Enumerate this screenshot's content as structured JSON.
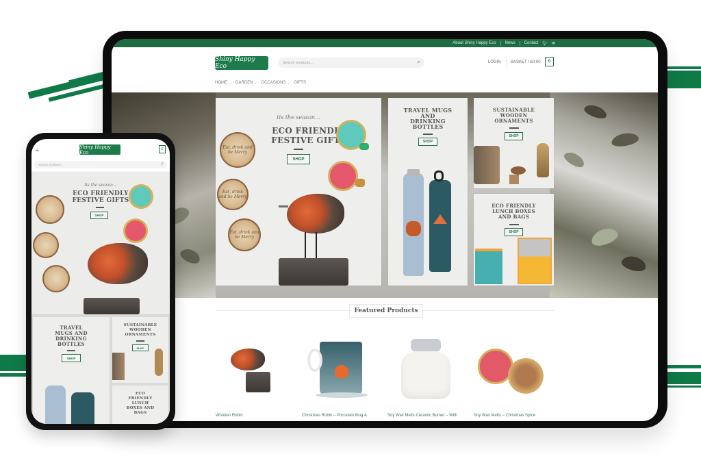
{
  "colors": {
    "brand_green": "#1f6b44",
    "link_green": "#3a7a57",
    "device_black": "#0c0c0c"
  },
  "desktop": {
    "topbar": {
      "links": [
        "About Shiny Happy Eco",
        "News",
        "Contact"
      ],
      "icons": [
        "twitter-icon",
        "email-icon"
      ]
    },
    "header": {
      "logo_text": "Shiny Happy Eco",
      "search_placeholder": "Search products...",
      "login_label": "LOGIN",
      "basket_label": "BASKET / £0.00",
      "basket_count": "0"
    },
    "nav": {
      "items": [
        {
          "label": "HOME",
          "has_dropdown": true
        },
        {
          "label": "GARDEN",
          "has_dropdown": true
        },
        {
          "label": "OCCASIONS",
          "has_dropdown": true
        },
        {
          "label": "GIFTS",
          "has_dropdown": false
        }
      ]
    },
    "hero": {
      "main": {
        "subtitle": "tis the season...",
        "title_line1": "ECO FRIENDLY",
        "title_line2": "FESTIVE GIFTS",
        "button": "SHOP",
        "coaster_text": "Eat, drink and be Merry"
      },
      "travel": {
        "title_lines": [
          "TRAVEL MUGS",
          "AND",
          "DRINKING",
          "BOTTLES"
        ],
        "button": "SHOP"
      },
      "ornaments": {
        "title_lines": [
          "SUSTAINABLE",
          "WOODEN",
          "ORNAMENTS"
        ],
        "button": "SHOP"
      },
      "lunch": {
        "title_lines": [
          "ECO FRIENDLY",
          "LUNCH BOXES",
          "AND BAGS"
        ],
        "button": "SHOP"
      }
    },
    "featured": {
      "heading": "Featured Products",
      "products": [
        {
          "name": "Wooden Robin"
        },
        {
          "name": "Christmas Robin – Porcelain Mug &"
        },
        {
          "name": "Soy Wax Melts Ceramic Burner – With"
        },
        {
          "name": "Soy Wax Melts – Christmas Spice"
        }
      ]
    }
  },
  "mobile": {
    "logo_text": "Shiny Happy Eco",
    "basket_count": "0",
    "search_placeholder": "Search products...",
    "hero": {
      "main": {
        "subtitle": "tis the season...",
        "title_line1": "ECO FRIENDLY",
        "title_line2": "FESTIVE GIFTS",
        "button": "SHOP"
      },
      "travel": {
        "title_lines": [
          "TRAVEL",
          "MUGS AND",
          "DRINKING",
          "BOTTLES"
        ],
        "button": "SHOP"
      },
      "ornaments": {
        "title_lines": [
          "SUSTAINABLE",
          "WOODEN",
          "ORNAMENTS"
        ],
        "button": "SHOP"
      },
      "lunch": {
        "title_lines": [
          "ECO",
          "FRIENDLY",
          "LUNCH",
          "BOXES AND",
          "BAGS"
        ]
      }
    }
  }
}
